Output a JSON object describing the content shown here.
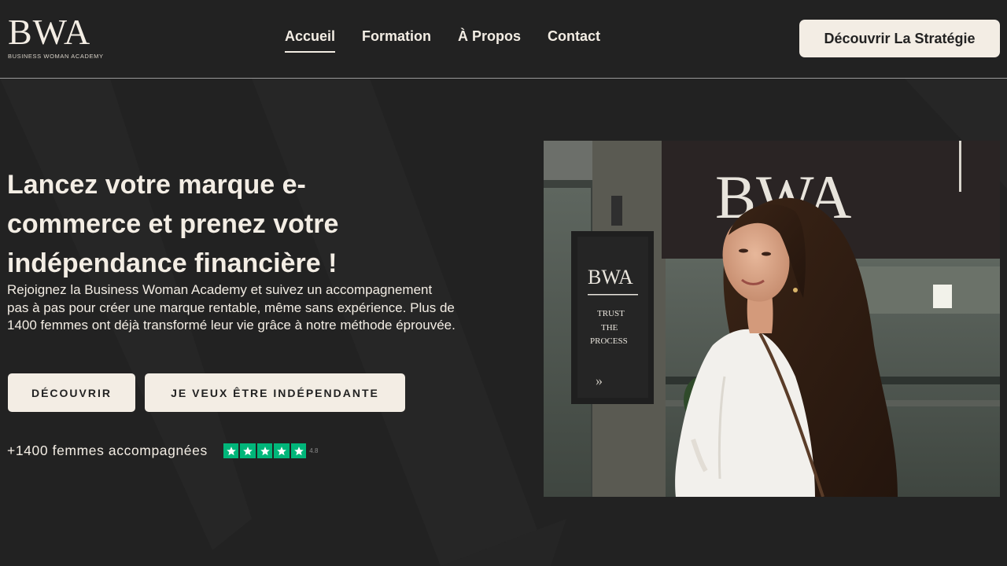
{
  "logo": {
    "mark": "BWA",
    "subtitle": "BUSINESS WOMAN ACADEMY"
  },
  "nav": {
    "items": [
      {
        "label": "Accueil",
        "active": true
      },
      {
        "label": "Formation",
        "active": false
      },
      {
        "label": "À Propos",
        "active": false
      },
      {
        "label": "Contact",
        "active": false
      }
    ]
  },
  "header_cta": {
    "label": "Découvrir La Stratégie"
  },
  "hero": {
    "title_lines": [
      "Lancez votre marque e-",
      "commerce et prenez votre",
      "indépendance financière !"
    ],
    "description": "Rejoignez la Business Woman Academy et suivez un accompagnement pas à pas pour créer une marque rentable, même sans expérience. Plus de 1400 femmes ont déjà transformé leur vie grâce à notre méthode éprouvée.",
    "buttons": {
      "discover": "DÉCOUVRIR",
      "independent": "JE VEUX ÊTRE INDÉPENDANTE"
    },
    "social_proof": {
      "text": "+1400 femmes accompagnées",
      "stars": 5,
      "rating": "4.8"
    }
  },
  "photo": {
    "sign_big": "BWA",
    "sign_small": "BWA",
    "sign_lines": [
      "TRUST",
      "THE",
      "PROCESS"
    ],
    "sign_arrows": "»"
  },
  "colors": {
    "background": "#222222",
    "cream": "#f3ede4",
    "star_green": "#00b67a"
  }
}
